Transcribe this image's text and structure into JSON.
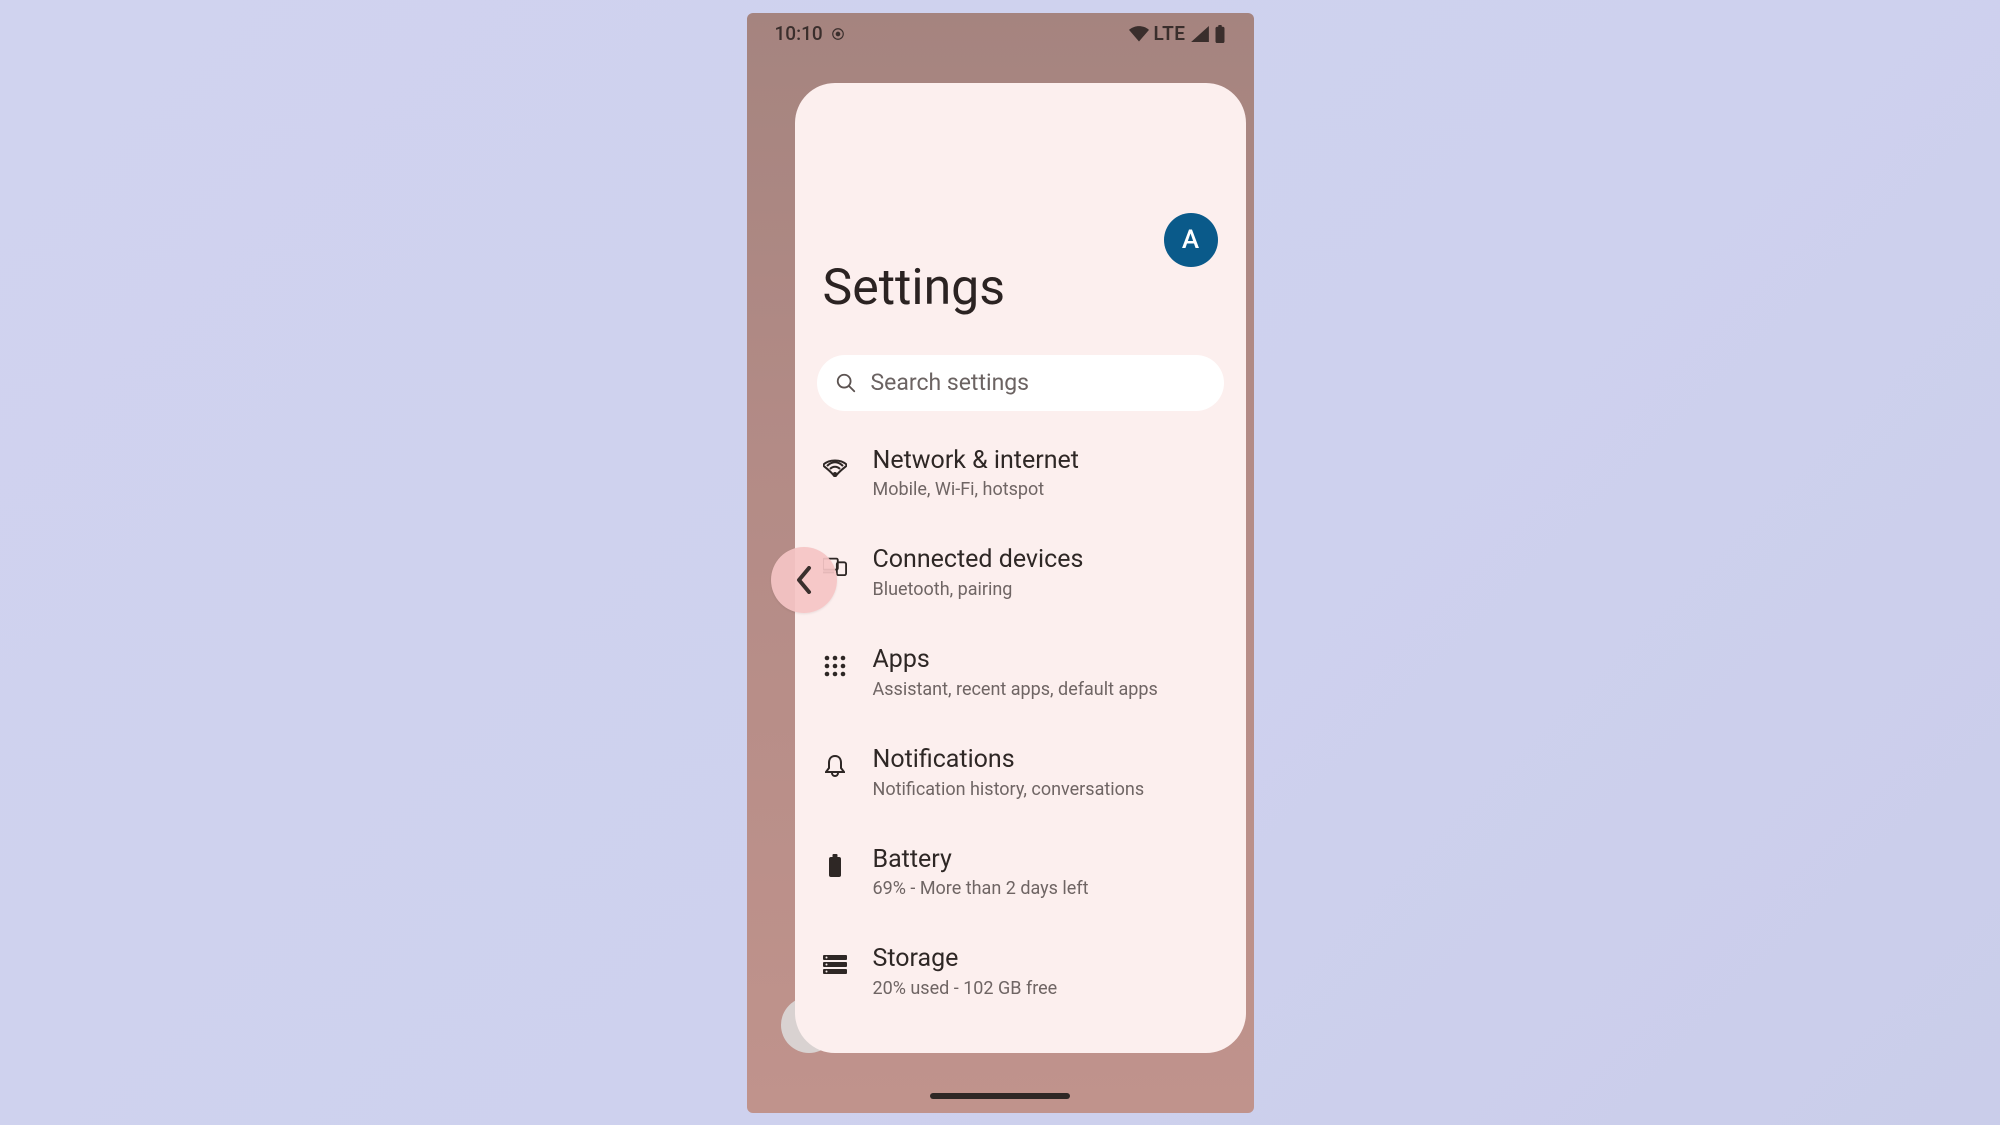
{
  "status": {
    "time": "10:10",
    "network_label": "LTE"
  },
  "header": {
    "title": "Settings",
    "avatar_initial": "A"
  },
  "search": {
    "placeholder": "Search settings"
  },
  "items": [
    {
      "icon": "wifi",
      "title": "Network & internet",
      "sub": "Mobile, Wi-Fi, hotspot"
    },
    {
      "icon": "devices",
      "title": "Connected devices",
      "sub": "Bluetooth, pairing"
    },
    {
      "icon": "apps",
      "title": "Apps",
      "sub": "Assistant, recent apps, default apps"
    },
    {
      "icon": "bell",
      "title": "Notifications",
      "sub": "Notification history, conversations"
    },
    {
      "icon": "battery",
      "title": "Battery",
      "sub": "69% - More than 2 days left"
    },
    {
      "icon": "storage",
      "title": "Storage",
      "sub": "20% used - 102 GB free"
    }
  ]
}
